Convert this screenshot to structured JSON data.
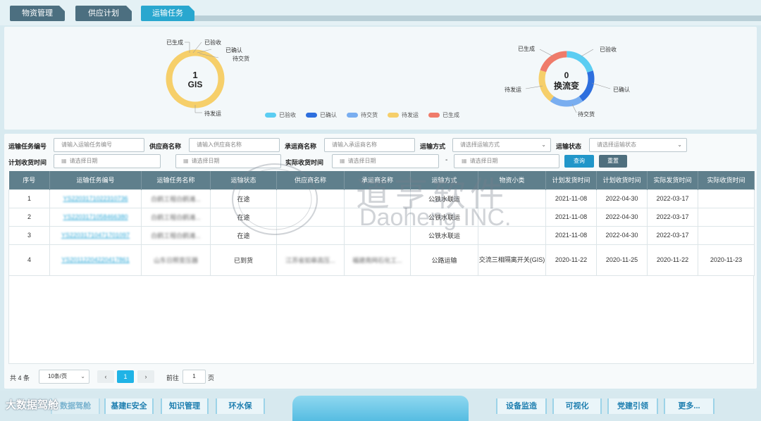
{
  "tabs": [
    {
      "label": "物资管理"
    },
    {
      "label": "供应计划"
    },
    {
      "label": "运输任务"
    }
  ],
  "donut_left": {
    "center_value": "1",
    "center_label": "GIS",
    "labels": {
      "generated": "已生成",
      "inspected": "已验收",
      "confirmed": "已确认",
      "pending_delivery": "待交货",
      "pending_shipment": "待发运"
    },
    "dominant_status": "待发运"
  },
  "donut_right": {
    "center_value": "0",
    "center_label": "换流变",
    "labels": {
      "generated": "已生成",
      "inspected": "已验收",
      "confirmed": "已确认",
      "pending_delivery": "待交货",
      "pending_shipment": "待发运"
    }
  },
  "legend": [
    {
      "label": "已验收",
      "color": "#5bcdf2"
    },
    {
      "label": "已确认",
      "color": "#2e6fde"
    },
    {
      "label": "待交货",
      "color": "#79aef0"
    },
    {
      "label": "待发运",
      "color": "#f6cf6a"
    },
    {
      "label": "已生成",
      "color": "#ef7b6a"
    }
  ],
  "filters": {
    "task_no_label": "运输任务编号",
    "task_no_placeholder": "请输入运输任务编号",
    "supplier_label": "供应商名称",
    "supplier_placeholder": "请输入供应商名称",
    "carrier_label": "承运商名称",
    "carrier_placeholder": "请输入承运商名称",
    "mode_label": "运输方式",
    "mode_placeholder": "请选择运输方式",
    "status_label": "运输状态",
    "status_placeholder": "请选择运输状态",
    "plan_recv_label": "计划收货时间",
    "actual_recv_label": "实际收货时间",
    "date_placeholder": "请选择日期",
    "dash": "-",
    "query": "查询",
    "reset": "重置"
  },
  "table": {
    "headers": [
      "序号",
      "运输任务编号",
      "运输任务名称",
      "运输状态",
      "供应商名称",
      "承运商名称",
      "运输方式",
      "物资小类",
      "计划发货时间",
      "计划收货时间",
      "实际发货时间",
      "实际收货时间"
    ],
    "rows": [
      [
        "1",
        "YS220317102231073​6",
        "白鹤工程白鹤滩...",
        "在途",
        "",
        "",
        "公铁水联运",
        "",
        "2021-11-08",
        "2022-04-30",
        "2022-03-17",
        ""
      ],
      [
        "2",
        "YS220317105846638​0",
        "白鹤工程白鹤滩...",
        "在途",
        "",
        "",
        "公铁水联运",
        "",
        "2021-11-08",
        "2022-04-30",
        "2022-03-17",
        ""
      ],
      [
        "3",
        "YS220317104717010​97",
        "白鹤工程白鹤滩...",
        "在途",
        "",
        "",
        "公铁水联运",
        "",
        "2021-11-08",
        "2022-04-30",
        "2022-03-17",
        ""
      ],
      [
        "4",
        "YS201122042204178​61",
        "山东日照变压器",
        "已到货",
        "江苏省如皋高压...",
        "福建南网石化工...",
        "公路运输",
        "交流三相隔离开关(GIS)",
        "2020-11-22",
        "2020-11-25",
        "2020-11-22",
        "2020-11-23"
      ]
    ]
  },
  "pager": {
    "total": "共 4 条",
    "size": "10条/页",
    "prev": "‹",
    "current": "1",
    "next": "›",
    "goto_label": "前往",
    "goto_value": "1",
    "page_unit": "页"
  },
  "bottom_nav": {
    "left": [
      "基建E安全",
      "知识管理",
      "环水保"
    ],
    "right": [
      "设备监造",
      "可视化",
      "党建引领",
      "更多..."
    ],
    "partial": "数据驾舱"
  },
  "watermark": {
    "cn": "道亨软件",
    "en": "Daoheng INC.",
    "logo": "大数据驾舱"
  }
}
